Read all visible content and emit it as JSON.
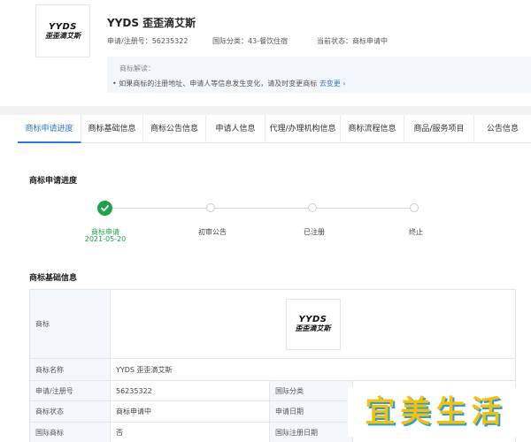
{
  "trademark": {
    "logo_en": "YYDS",
    "logo_cn": "歪歪滴艾斯",
    "name": "YYDS 歪歪滴艾斯",
    "reg_no": "申请/注册号：56235322",
    "intl_class": "国际分类：43-餐饮住宿",
    "status": "当前状态：商标申请中"
  },
  "interpretation": {
    "title": "商标解读：",
    "bullet": "•",
    "text": "如果商标的注册地址、申请人等信息发生变化，请及时变更商标",
    "link": "去变更 ›"
  },
  "tabs": [
    {
      "label": "商标申请进度"
    },
    {
      "label": "商标基础信息"
    },
    {
      "label": "商标公告信息"
    },
    {
      "label": "申请人信息"
    },
    {
      "label": "代理/办理机构信息"
    },
    {
      "label": "商标流程信息"
    },
    {
      "label": "商品/服务项目"
    },
    {
      "label": "公告信息"
    }
  ],
  "progress": {
    "title": "商标申请进度",
    "steps": [
      {
        "label": "商标申请",
        "date": "2021-05-20"
      },
      {
        "label": "初审公告"
      },
      {
        "label": "已注册"
      },
      {
        "label": "终止"
      }
    ]
  },
  "basic_info": {
    "title": "商标基础信息",
    "rows": {
      "logo_label": "商标",
      "name_label": "商标名称",
      "name_value": "YYDS 歪歪滴艾斯",
      "regno_label": "申请/注册号",
      "regno_value": "56235322",
      "class_label": "国际分类",
      "class_value": "43-餐饮住宿",
      "status_label": "商标状态",
      "status_value": "商标申请中",
      "appdate_label": "申请日期",
      "intl_label": "国际商标",
      "intl_value": "否",
      "intl_regdate_label": "国际注册日期"
    }
  },
  "watermark": {
    "chars": [
      "宜",
      "美",
      "生",
      "活"
    ]
  },
  "colors": {
    "accent": "#2f7ad8",
    "success": "#1fa34a",
    "label_bg": "#f3f6fa"
  }
}
